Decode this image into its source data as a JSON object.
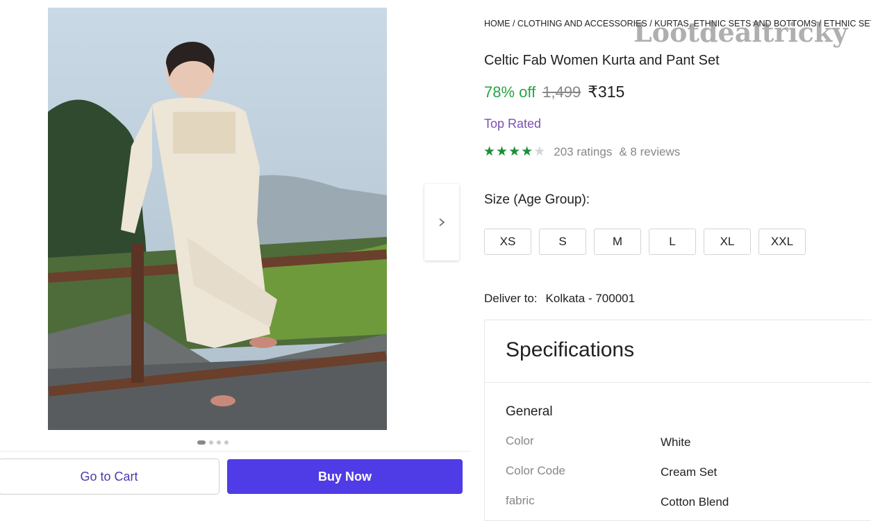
{
  "breadcrumb": "HOME / CLOTHING AND ACCESSORIES / KURTAS, ETHNIC SETS AND BOTTOMS / ETHNIC SETS",
  "watermark": "Lootdealtricky",
  "product": {
    "title": "Celtic Fab Women Kurta and Pant Set",
    "discount": "78% off",
    "mrp": "1,499",
    "price": "₹315",
    "badge": "Top Rated",
    "rating_stars": 4,
    "ratings": "203 ratings",
    "reviews": "& 8 reviews"
  },
  "gallery": {
    "image_count": 4,
    "active_index": 0,
    "next_icon": "chevron-right-icon"
  },
  "size": {
    "label": "Size (Age Group):",
    "options": [
      "XS",
      "S",
      "M",
      "L",
      "XL",
      "XXL"
    ]
  },
  "delivery": {
    "label": "Deliver to:",
    "location": "Kolkata - 700001"
  },
  "specifications": {
    "title": "Specifications",
    "section": "General",
    "rows": [
      {
        "key": "Color",
        "value": "White"
      },
      {
        "key": "Color Code",
        "value": "Cream Set"
      },
      {
        "key": "fabric",
        "value": "Cotton Blend"
      }
    ]
  },
  "actions": {
    "cart_label": "Go to Cart",
    "buy_label": "Buy Now"
  },
  "colors": {
    "discount": "#26a541",
    "buy_button": "#4f3ce6",
    "top_rated": "#7c4fb3",
    "star": "#1b8f3a"
  }
}
